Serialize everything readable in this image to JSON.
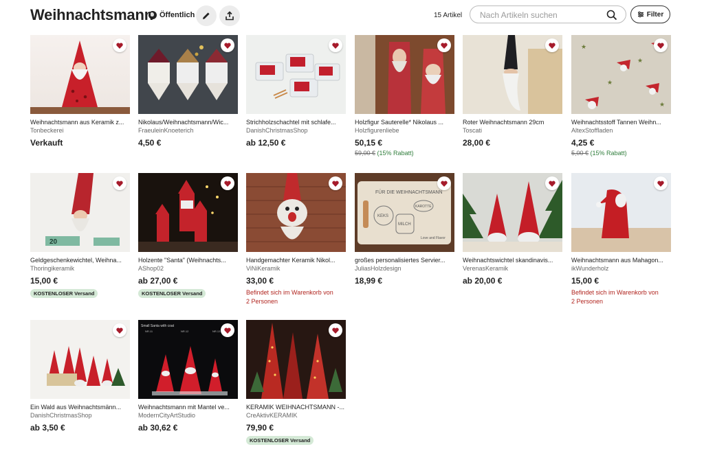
{
  "header": {
    "title": "Weihnachtsmann",
    "visibility": "Öffentlich",
    "item_count": "15 Artikel",
    "search_placeholder": "Nach Artikeln suchen",
    "filter_label": "Filter"
  },
  "items": [
    {
      "title": "Weihnachtsmann aus Keramik z...",
      "shop": "Tonbeckerei",
      "price": "Verkauft"
    },
    {
      "title": "Nikolaus/Weihnachtsmann/Wic...",
      "shop": "FraeuleinKnoeterich",
      "price": "4,50 €"
    },
    {
      "title": "Strichholzschachtel mit schlafe...",
      "shop": "DanishChristmasShop",
      "price": "ab 12,50 €"
    },
    {
      "title": "Holzfigur Sauterelle* Nikolaus ...",
      "shop": "Holzfigurenliebe",
      "price": "50,15 €",
      "original_price": "59,00 €",
      "discount": "(15% Rabatt)"
    },
    {
      "title": "Roter Weihnachtsmann 29cm",
      "shop": "Toscati",
      "price": "28,00 €"
    },
    {
      "title": "Weihnachtsstoff Tannen Weihn...",
      "shop": "AltexStoffladen",
      "price": "4,25 €",
      "original_price": "5,00 €",
      "discount": "(15% Rabatt)"
    },
    {
      "title": "Geldgeschenkewichtel, Weihna...",
      "shop": "Thoringikeramik",
      "price": "15,00 €",
      "badge": "KOSTENLOSER Versand"
    },
    {
      "title": "Holzente \"Santa\" (Weihnachts...",
      "shop": "AShop02",
      "price": "ab 27,00 €",
      "badge": "KOSTENLOSER Versand"
    },
    {
      "title": "Handgemachter Keramik Nikol...",
      "shop": "ViNiKeramik",
      "price": "33,00 €",
      "cart_line1": "Befindet sich im Warenkorb von",
      "cart_line2": "2 Personen"
    },
    {
      "title": "großes personalisiertes Servier...",
      "shop": "JuliasHolzdesign",
      "price": "18,99 €"
    },
    {
      "title": "Weihnachtswichtel skandinavis...",
      "shop": "VerenasKeramik",
      "price": "ab 20,00 €"
    },
    {
      "title": "Weihnachtsmann aus Mahagon...",
      "shop": "ikWunderholz",
      "price": "15,00 €",
      "cart_line1": "Befindet sich im Warenkorb von",
      "cart_line2": "2 Personen"
    },
    {
      "title": "Ein Wald aus Weihnachtsmänn...",
      "shop": "DanishChristmasShop",
      "price": "ab 3,50 €"
    },
    {
      "title": "Weihnachtsmann mit Mantel ve...",
      "shop": "ModernCityArtStudio",
      "price": "ab 30,62 €"
    },
    {
      "title": "KERAMIK WEIHNACHTSMANN -...",
      "shop": "CreAktivKERAMIK",
      "price": "79,90 €",
      "badge": "KOSTENLOSER Versand"
    }
  ],
  "image_text": {
    "bill": "20",
    "board_top": "FÜR DIE WEIHNACHTSMANN",
    "board_left": "KEKS",
    "board_mid": "MILCH",
    "board_right": "KAROTTE",
    "board_sign": "Love and Flavor",
    "small_santa": "Small Santa with coat",
    "label1": "NR.11",
    "label2": "NR.12",
    "label3": "NR.13"
  },
  "colors": {
    "favorite_heart": "#a61b2b",
    "discount": "#2f7d3b",
    "cart_notice": "#b1251f",
    "badge_bg": "#d4e9d6"
  }
}
